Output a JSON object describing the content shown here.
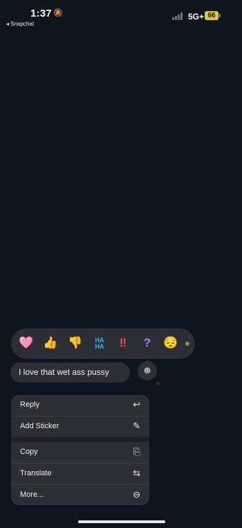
{
  "status_bar": {
    "time": "1:37",
    "silent_icon": "bell-slash-icon",
    "back_app": "◂ Snapchat",
    "network": "5G+",
    "battery": "66"
  },
  "reactions": [
    {
      "name": "heart-reaction",
      "glyph": "🩷"
    },
    {
      "name": "thumbs-up-reaction",
      "glyph": "👍"
    },
    {
      "name": "thumbs-down-reaction",
      "glyph": "👎"
    },
    {
      "name": "haha-reaction",
      "glyph": "HA HA"
    },
    {
      "name": "exclamation-reaction",
      "glyph": "‼"
    },
    {
      "name": "question-reaction",
      "glyph": "?"
    },
    {
      "name": "emoji-reaction",
      "glyph": "😔"
    }
  ],
  "message": {
    "text": "I love that wet ass pussy"
  },
  "tapback_icon": "add-emoji-icon",
  "menu": {
    "items": [
      {
        "label": "Reply",
        "icon": "↩"
      },
      {
        "label": "Add Sticker",
        "icon": "✎"
      },
      {
        "label": "Copy",
        "icon": "⎘"
      },
      {
        "label": "Translate",
        "icon": "⇆"
      },
      {
        "label": "More...",
        "icon": "⊖"
      }
    ]
  }
}
